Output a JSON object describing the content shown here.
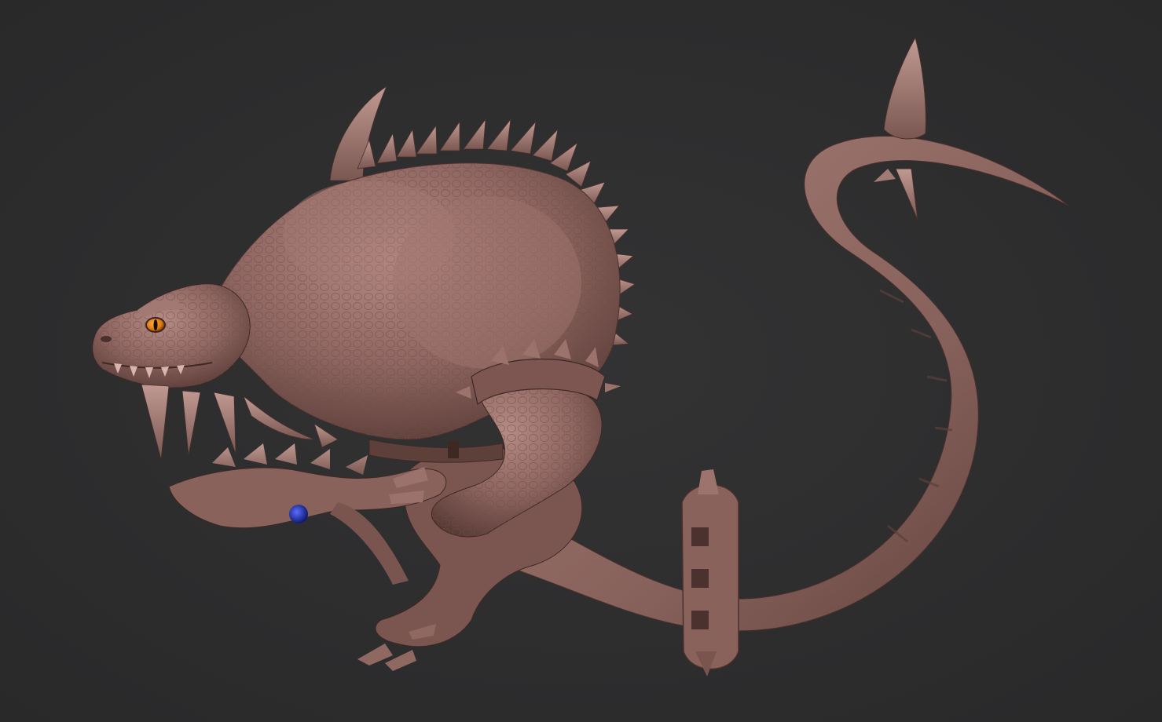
{
  "scene": {
    "background_color": "#2d2d2e",
    "clay_color": "#8e6560",
    "clay_highlight": "#b48a83",
    "clay_shadow": "#4a302c",
    "eye_color": "#d9780e",
    "gem_color": "#1d2fa0"
  }
}
